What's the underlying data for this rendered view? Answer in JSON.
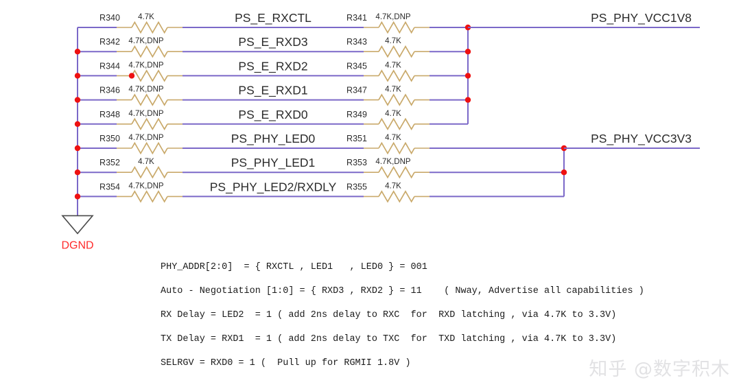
{
  "diagram": {
    "title": "Ethernet PHY strap resistor schematic",
    "colors": {
      "wire": "#7b68c8",
      "resistor": "#c9a96a",
      "junction": "#ee1111",
      "ground_label": "#ff2a2a",
      "text": "#2b2b2b",
      "note_text": "#1a1a1a",
      "watermark": "#e2e2e4",
      "background": "#ffffff"
    },
    "ground": {
      "label": "DGND",
      "symbol": "ground-triangle"
    },
    "power_nets": [
      {
        "name": "PS_PHY_VCC1V8"
      },
      {
        "name": "PS_PHY_VCC3V3"
      }
    ],
    "rows": [
      {
        "net": "PS_E_RXCTL",
        "left": {
          "ref": "R340",
          "value": "4.7K"
        },
        "right": {
          "ref": "R341",
          "value": "4.7K,DNP"
        },
        "rail": "PS_PHY_VCC1V8"
      },
      {
        "net": "PS_E_RXD3",
        "left": {
          "ref": "R342",
          "value": "4.7K,DNP"
        },
        "right": {
          "ref": "R343",
          "value": "4.7K"
        },
        "rail": "PS_PHY_VCC1V8"
      },
      {
        "net": "PS_E_RXD2",
        "left": {
          "ref": "R344",
          "value": "4.7K,DNP"
        },
        "right": {
          "ref": "R345",
          "value": "4.7K"
        },
        "rail": "PS_PHY_VCC1V8"
      },
      {
        "net": "PS_E_RXD1",
        "left": {
          "ref": "R346",
          "value": "4.7K,DNP"
        },
        "right": {
          "ref": "R347",
          "value": "4.7K"
        },
        "rail": "PS_PHY_VCC1V8"
      },
      {
        "net": "PS_E_RXD0",
        "left": {
          "ref": "R348",
          "value": "4.7K,DNP"
        },
        "right": {
          "ref": "R349",
          "value": "4.7K"
        },
        "rail": "PS_PHY_VCC1V8"
      },
      {
        "net": "PS_PHY_LED0",
        "left": {
          "ref": "R350",
          "value": "4.7K,DNP"
        },
        "right": {
          "ref": "R351",
          "value": "4.7K"
        },
        "rail": "PS_PHY_VCC3V3"
      },
      {
        "net": "PS_PHY_LED1",
        "left": {
          "ref": "R352",
          "value": "4.7K"
        },
        "right": {
          "ref": "R353",
          "value": "4.7K,DNP"
        },
        "rail": "PS_PHY_VCC3V3"
      },
      {
        "net": "PS_PHY_LED2/RXDLY",
        "left": {
          "ref": "R354",
          "value": "4.7K,DNP"
        },
        "right": {
          "ref": "R355",
          "value": "4.7K"
        },
        "rail": "PS_PHY_VCC3V3"
      }
    ]
  },
  "notes": [
    "PHY_ADDR[2:0]  = { RXCTL , LED1   , LED0 } = 001",
    "Auto - Negotiation [1:0] = { RXD3 , RXD2 } = 11    ( Nway, Advertise all capabilities )",
    "RX Delay = LED2  = 1 ( add 2ns delay to RXC  for  RXD latching , via 4.7K to 3.3V)",
    "TX Delay = RXD1  = 1 ( add 2ns delay to TXC  for  TXD latching , via 4.7K to 3.3V)",
    "SELRGV = RXD0 = 1 (  Pull up for RGMII 1.8V )"
  ],
  "watermark": {
    "text": "知乎 @数字积木"
  }
}
